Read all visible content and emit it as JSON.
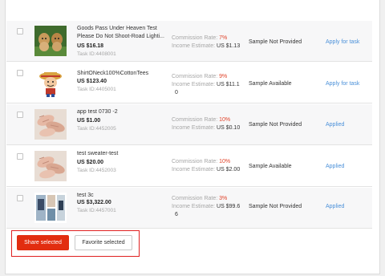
{
  "products": [
    {
      "name": "Goods Pass Under Heaven Test Please Do Not Shoot-Road Lighti...",
      "price": "US $16.18",
      "task_id": "Task ID:4408001",
      "commission_label": "Commission Rate: ",
      "commission_value": "7%",
      "income_label": "Income Estimate: ",
      "income_value": "US $1.13",
      "income_value_cont": "",
      "sample": "Sample Not Provided",
      "action": "Apply for task",
      "thumb_icon": "dogs-photo-icon"
    },
    {
      "name": "ShirtONeck100%CottonTees",
      "price": "US $123.40",
      "task_id": "Task ID:4405001",
      "commission_label": "Commission Rate: ",
      "commission_value": "9%",
      "income_label": "Income Estimate: ",
      "income_value": "US $11.1",
      "income_value_cont": "0",
      "sample": "Sample Available",
      "action": "Apply for task",
      "thumb_icon": "cartoon-pirate-icon"
    },
    {
      "name": "app test 0730 -2",
      "price": "US $1.00",
      "task_id": "Task ID:4452005",
      "commission_label": "Commission Rate: ",
      "commission_value": "10%",
      "income_label": "Income Estimate: ",
      "income_value": "US $0.10",
      "income_value_cont": "",
      "sample": "Sample Not Provided",
      "action": "Applied",
      "thumb_icon": "hands-photo-icon"
    },
    {
      "name": "test sweater-test",
      "price": "US $20.00",
      "task_id": "Task ID:4452003",
      "commission_label": "Commission Rate: ",
      "commission_value": "10%",
      "income_label": "Income Estimate: ",
      "income_value": "US $2.00",
      "income_value_cont": "",
      "sample": "Sample Available",
      "action": "Applied",
      "thumb_icon": "hands-photo-icon"
    },
    {
      "name": "test 3c",
      "price": "US $3,322.00",
      "task_id": "Task ID:4457001",
      "commission_label": "Commission Rate: ",
      "commission_value": "3%",
      "income_label": "Income Estimate: ",
      "income_value": "US $99.6",
      "income_value_cont": "6",
      "sample": "Sample Not Provided",
      "action": "Applied",
      "thumb_icon": "fashion-collage-icon"
    }
  ],
  "footer": {
    "share_label": "Share selected",
    "favorite_label": "Favorite selected"
  },
  "colors": {
    "accent_red": "#e22d10",
    "link_blue": "#4a90d9",
    "rate_red": "#e0432a"
  }
}
